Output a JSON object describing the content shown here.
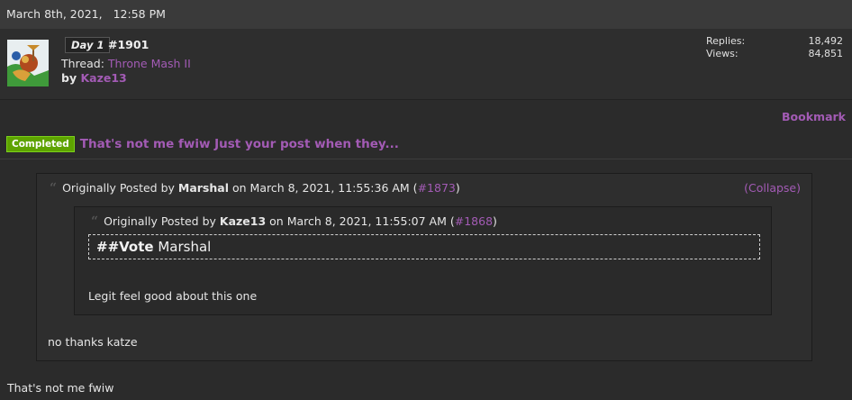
{
  "header": {
    "date": "March 8th, 2021,",
    "time": "12:58 PM"
  },
  "thread": {
    "day_badge": "Day 1",
    "post_number": "#1901",
    "thread_prefix": "Thread:",
    "thread_name": "Throne Mash II",
    "by_prefix": "by",
    "author": "Kaze13",
    "avatar_icon": "avatar-image-icon",
    "stats": {
      "replies_label": "Replies:",
      "replies_value": "18,492",
      "views_label": "Views:",
      "views_value": "84,851"
    }
  },
  "bookmark_label": "Bookmark",
  "status_badge": "Completed",
  "post_title": "That's not me fwiw Just your post when they...",
  "outer_quote": {
    "prefix": "Originally Posted by",
    "author": "Marshal",
    "on": "on March 8, 2021, 11:55:36 AM (",
    "link": "#1873",
    "close": ")",
    "collapse": "(Collapse)",
    "body": "no thanks katze"
  },
  "inner_quote": {
    "prefix": "Originally Posted by",
    "author": "Kaze13",
    "on": "on March 8, 2021, 11:55:07 AM (",
    "link": "#1868",
    "close": ")",
    "vote_cmd": "##Vote",
    "vote_target": "Marshal",
    "body": "Legit feel good about this one"
  },
  "reply_text": "That's not me fwiw",
  "colors": {
    "accent": "#a35bb5",
    "completed": "#5ea300",
    "background": "#2b2b2b"
  }
}
